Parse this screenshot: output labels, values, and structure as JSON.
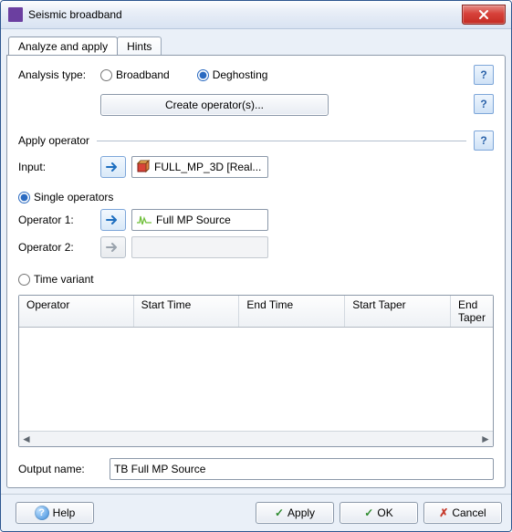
{
  "window": {
    "title": "Seismic broadband"
  },
  "tabs": {
    "analyze": "Analyze and apply",
    "hints": "Hints"
  },
  "analysis": {
    "label": "Analysis type:",
    "broadband": "Broadband",
    "deghosting": "Deghosting",
    "create_btn": "Create operator(s)..."
  },
  "apply_section": {
    "title": "Apply operator",
    "input_label": "Input:",
    "input_value": "FULL_MP_3D [Real..."
  },
  "operators": {
    "single_label": "Single operators",
    "op1_label": "Operator 1:",
    "op1_value": "Full MP Source",
    "op2_label": "Operator 2:",
    "timevar_label": "Time variant"
  },
  "table": {
    "cols": {
      "operator": "Operator",
      "start_time": "Start Time",
      "end_time": "End Time",
      "start_taper": "Start Taper",
      "end_taper": "End Taper"
    }
  },
  "output": {
    "label": "Output  name:",
    "value": "TB Full MP Source"
  },
  "footer": {
    "help": "Help",
    "apply": "Apply",
    "ok": "OK",
    "cancel": "Cancel"
  },
  "icons": {
    "help_q": "?",
    "close": "✕",
    "check": "✓",
    "x": "✗",
    "left": "◄",
    "right": "►"
  }
}
